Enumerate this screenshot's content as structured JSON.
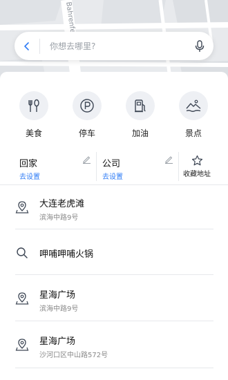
{
  "map": {
    "street_label": "Bahrenfelder"
  },
  "search": {
    "placeholder": "你想去哪里?",
    "back_icon": "chevron-left-icon",
    "mic_icon": "microphone-icon"
  },
  "categories": [
    {
      "label": "美食",
      "icon": "food-icon"
    },
    {
      "label": "停车",
      "icon": "parking-icon"
    },
    {
      "label": "加油",
      "icon": "fuel-icon"
    },
    {
      "label": "景点",
      "icon": "scenic-icon"
    }
  ],
  "quick": {
    "home": {
      "title": "回家",
      "sub": "去设置"
    },
    "work": {
      "title": "公司",
      "sub": "去设置"
    },
    "favorites": {
      "label": "收藏地址"
    }
  },
  "places": [
    {
      "name": "大连老虎滩",
      "address": "滨海中路9号",
      "icon": "location-pin-icon"
    },
    {
      "name": "呷哺呷哺火锅",
      "address": "",
      "icon": "search-icon"
    },
    {
      "name": "星海广场",
      "address": "滨海中路9号",
      "icon": "location-pin-icon"
    },
    {
      "name": "星海广场",
      "address": "沙河口区中山路572号",
      "icon": "location-pin-icon"
    }
  ],
  "colors": {
    "accent": "#2f7cf6",
    "icon_bg": "#eef0f4",
    "icon_stroke": "#3d4654"
  }
}
